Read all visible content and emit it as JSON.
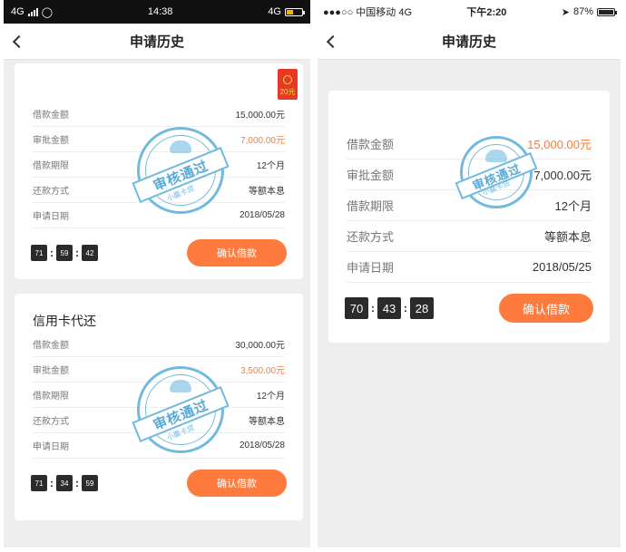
{
  "left_screen": {
    "status": {
      "network": "4G",
      "network_right": "4G",
      "time": "14:38"
    },
    "nav": {
      "title": "申请历史"
    },
    "coupon": {
      "label": "20元"
    },
    "card1": {
      "title": "",
      "rows": [
        {
          "label": "借款金额",
          "value": "15,000.00元"
        },
        {
          "label": "审批金额",
          "value": "7,000.00元"
        },
        {
          "label": "借款期限",
          "value": "12个月"
        },
        {
          "label": "还款方式",
          "value": "等额本息"
        },
        {
          "label": "申请日期",
          "value": "2018/05/28"
        }
      ],
      "timer": [
        "71",
        "59",
        "42"
      ],
      "button": "确认借款",
      "stamp": {
        "main": "审核通过",
        "sub": "小赢卡贷"
      }
    },
    "card2": {
      "title": "信用卡代还",
      "rows": [
        {
          "label": "借款金额",
          "value": "30,000.00元"
        },
        {
          "label": "审批金额",
          "value": "3,500.00元"
        },
        {
          "label": "借款期限",
          "value": "12个月"
        },
        {
          "label": "还款方式",
          "value": "等额本息"
        },
        {
          "label": "申请日期",
          "value": "2018/05/28"
        }
      ],
      "timer": [
        "71",
        "34",
        "59"
      ],
      "button": "确认借款",
      "stamp": {
        "main": "审核通过",
        "sub": "小赢卡贷"
      }
    }
  },
  "right_screen": {
    "status": {
      "carrier": "●●●○○ 中国移动  4G",
      "time": "下午2:20",
      "battery": "87%"
    },
    "nav": {
      "title": "申请历史"
    },
    "card": {
      "title": "",
      "rows": [
        {
          "label": "借款金额",
          "value": "15,000.00元"
        },
        {
          "label": "审批金额",
          "value": "7,000.00元"
        },
        {
          "label": "借款期限",
          "value": "12个月"
        },
        {
          "label": "还款方式",
          "value": "等额本息"
        },
        {
          "label": "申请日期",
          "value": "2018/05/25"
        }
      ],
      "timer": [
        "70",
        "43",
        "28"
      ],
      "button": "确认借款",
      "stamp": {
        "main": "审核通过",
        "sub": "小赢卡贷"
      }
    }
  },
  "colors": {
    "accent": "#ff7a3d",
    "stamp": "#5aaed8",
    "coupon": "#e53b24"
  }
}
